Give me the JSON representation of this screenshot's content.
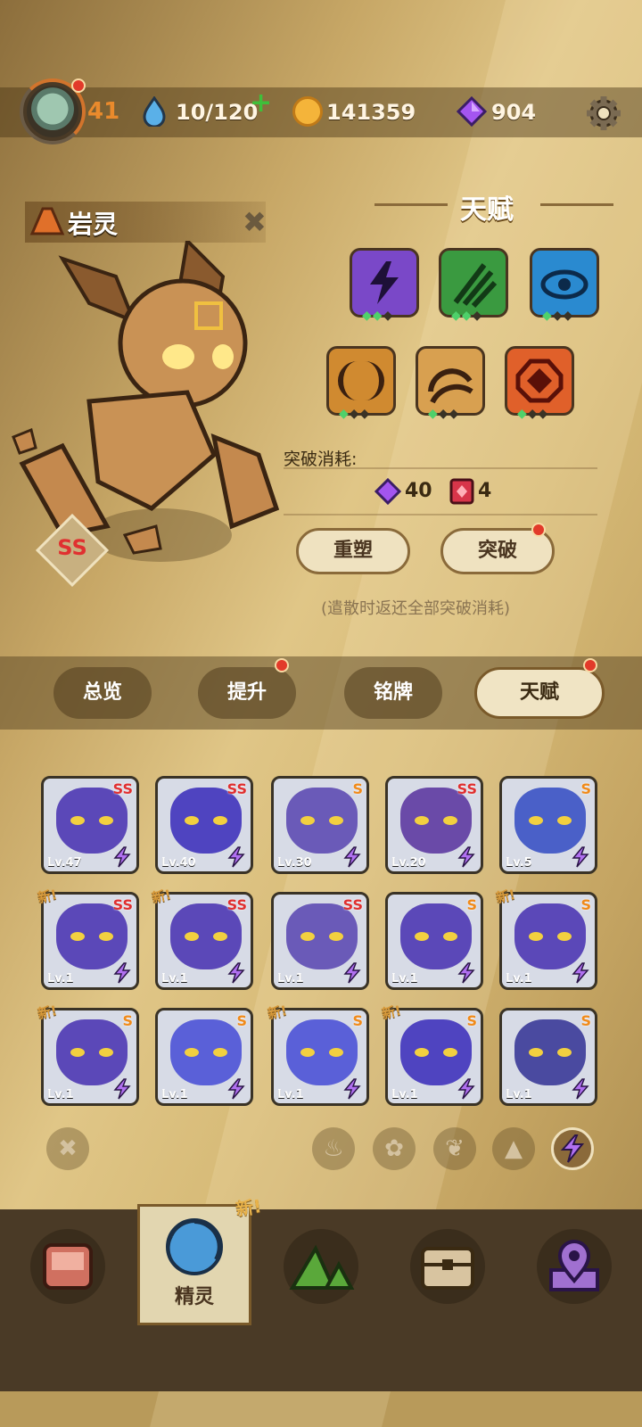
{
  "topbar": {
    "level": "41",
    "stamina": "10/120",
    "coins": "141359",
    "gems": "904",
    "icons": [
      "player-avatar",
      "water-drop-icon",
      "plus-icon",
      "coin-icon",
      "purple-gem-icon",
      "gear-icon"
    ]
  },
  "spirit": {
    "name": "岩灵",
    "rank": "SS"
  },
  "talent": {
    "title": "天赋",
    "skills": [
      {
        "icon": "lightning-talent-icon",
        "color": "#7a48c8"
      },
      {
        "icon": "claw-talent-icon",
        "color": "#3a9a40"
      },
      {
        "icon": "eye-talent-icon",
        "color": "#2a8ad0"
      },
      {
        "icon": "crescent-talent-icon",
        "color": "#d08a30"
      },
      {
        "icon": "wave-talent-icon",
        "color": "#d8a050"
      },
      {
        "icon": "gem-talent-icon",
        "color": "#e0602a"
      }
    ],
    "cost_label": "突破消耗:",
    "cost_gems": "40",
    "cost_books": "4",
    "reshape_label": "重塑",
    "breakthrough_label": "突破",
    "note": "(遣散时返还全部突破消耗)"
  },
  "tabs": [
    {
      "label": "总览",
      "active": false
    },
    {
      "label": "提升",
      "active": false,
      "dot": true
    },
    {
      "label": "铭牌",
      "active": false
    },
    {
      "label": "天赋",
      "active": true,
      "dot": true
    }
  ],
  "cards": [
    {
      "lv": "Lv.47",
      "rank": "SS",
      "kind": "cat"
    },
    {
      "lv": "Lv.40",
      "rank": "SS",
      "kind": "dragon"
    },
    {
      "lv": "Lv.30",
      "rank": "S",
      "kind": "mouse"
    },
    {
      "lv": "Lv.20",
      "rank": "SS",
      "kind": "unicorn"
    },
    {
      "lv": "Lv.5",
      "rank": "S",
      "kind": "cannon"
    },
    {
      "lv": "Lv.1",
      "rank": "SS",
      "kind": "cat",
      "new": true
    },
    {
      "lv": "Lv.1",
      "rank": "SS",
      "kind": "cat",
      "new": true
    },
    {
      "lv": "Lv.1",
      "rank": "SS",
      "kind": "mouse"
    },
    {
      "lv": "Lv.1",
      "rank": "S",
      "kind": "cat"
    },
    {
      "lv": "Lv.1",
      "rank": "S",
      "kind": "cat",
      "new": true
    },
    {
      "lv": "Lv.1",
      "rank": "S",
      "kind": "cat",
      "new": true
    },
    {
      "lv": "Lv.1",
      "rank": "S",
      "kind": "jelly"
    },
    {
      "lv": "Lv.1",
      "rank": "S",
      "kind": "jelly",
      "new": true
    },
    {
      "lv": "Lv.1",
      "rank": "S",
      "kind": "dragon",
      "new": true
    },
    {
      "lv": "Lv.1",
      "rank": "S",
      "kind": "croc"
    }
  ],
  "new_tag": "新!",
  "filters": [
    "clear-filter-icon",
    "fire-filter-icon",
    "flower-filter-icon",
    "leaf-filter-icon",
    "rock-filter-icon",
    "lightning-filter-icon"
  ],
  "nav": {
    "spirit_label": "精灵",
    "new_tag": "新!"
  }
}
